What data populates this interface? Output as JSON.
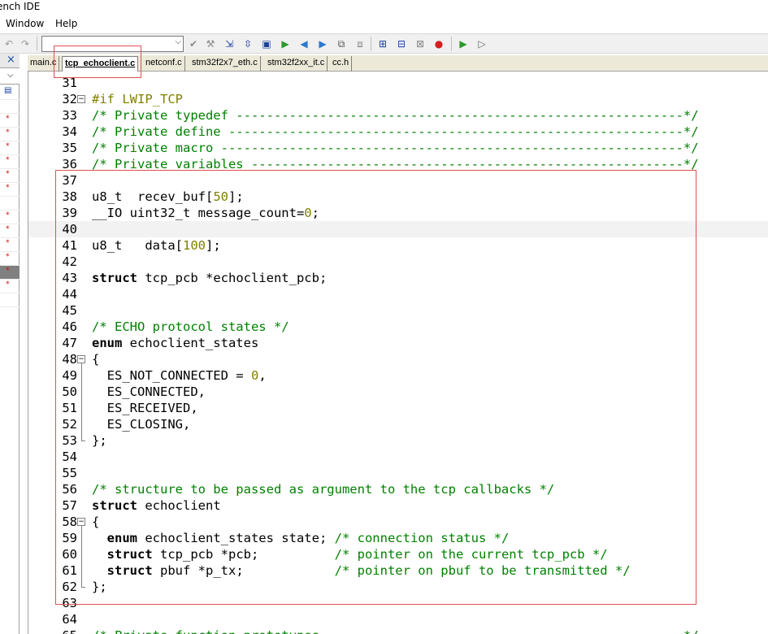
{
  "window": {
    "title": "ench IDE"
  },
  "menu": [
    {
      "label": "Window",
      "x": 7
    },
    {
      "label": "Help",
      "x": 68
    }
  ],
  "toolbar": {
    "combo_value": "",
    "combo_arrow": "⌵"
  },
  "left_pane": {
    "close_glyph": "×",
    "dropdown_glyph": "⌵"
  },
  "tabs": [
    {
      "label": "main.c",
      "active": false
    },
    {
      "label": "tcp_echoclient.c",
      "active": true
    },
    {
      "label": "netconf.c",
      "active": false
    },
    {
      "label": "stm32f2x7_eth.c",
      "active": false
    },
    {
      "label": "stm32f2xx_it.c",
      "active": false
    },
    {
      "label": "cc.h",
      "active": false
    }
  ],
  "code_lines": [
    {
      "n": "31",
      "tokens": []
    },
    {
      "n": "32",
      "fold": "open",
      "tokens": [
        {
          "t": "#if LWIP_TCP",
          "c": "pp"
        }
      ]
    },
    {
      "n": "33",
      "tokens": [
        {
          "t": "/* Private typedef -----------------------------------------------------------*/",
          "c": "cm"
        }
      ]
    },
    {
      "n": "34",
      "tokens": [
        {
          "t": "/* Private define ------------------------------------------------------------*/",
          "c": "cm"
        }
      ]
    },
    {
      "n": "35",
      "tokens": [
        {
          "t": "/* Private macro -------------------------------------------------------------*/",
          "c": "cm"
        }
      ]
    },
    {
      "n": "36",
      "tokens": [
        {
          "t": "/* Private variables ---------------------------------------------------------*/",
          "c": "cm"
        }
      ]
    },
    {
      "n": "37",
      "tokens": []
    },
    {
      "n": "38",
      "tokens": [
        {
          "t": "u8_t  recev_buf[",
          "c": "pl"
        },
        {
          "t": "50",
          "c": "num"
        },
        {
          "t": "];",
          "c": "pl"
        }
      ]
    },
    {
      "n": "39",
      "tokens": [
        {
          "t": "__IO uint32_t message_count=",
          "c": "pl"
        },
        {
          "t": "0",
          "c": "num"
        },
        {
          "t": ";",
          "c": "pl"
        }
      ]
    },
    {
      "n": "40",
      "hl": true,
      "tokens": []
    },
    {
      "n": "41",
      "tokens": [
        {
          "t": "u8_t   data[",
          "c": "pl"
        },
        {
          "t": "100",
          "c": "num"
        },
        {
          "t": "];",
          "c": "pl"
        }
      ]
    },
    {
      "n": "42",
      "tokens": []
    },
    {
      "n": "43",
      "tokens": [
        {
          "t": "struct",
          "c": "kw"
        },
        {
          "t": " tcp_pcb *echoclient_pcb;",
          "c": "pl"
        }
      ]
    },
    {
      "n": "44",
      "tokens": []
    },
    {
      "n": "45",
      "tokens": []
    },
    {
      "n": "46",
      "tokens": [
        {
          "t": "/* ECHO protocol states */",
          "c": "cm"
        }
      ]
    },
    {
      "n": "47",
      "tokens": [
        {
          "t": "enum",
          "c": "kw"
        },
        {
          "t": " echoclient_states",
          "c": "pl"
        }
      ]
    },
    {
      "n": "48",
      "fold": "open",
      "tokens": [
        {
          "t": "{",
          "c": "pl"
        }
      ]
    },
    {
      "n": "49",
      "tokens": [
        {
          "t": "  ES_NOT_CONNECTED = ",
          "c": "pl"
        },
        {
          "t": "0",
          "c": "num"
        },
        {
          "t": ",",
          "c": "pl"
        }
      ]
    },
    {
      "n": "50",
      "tokens": [
        {
          "t": "  ES_CONNECTED,",
          "c": "pl"
        }
      ]
    },
    {
      "n": "51",
      "tokens": [
        {
          "t": "  ES_RECEIVED,",
          "c": "pl"
        }
      ]
    },
    {
      "n": "52",
      "tokens": [
        {
          "t": "  ES_CLOSING,",
          "c": "pl"
        }
      ]
    },
    {
      "n": "53",
      "fold": "end",
      "tokens": [
        {
          "t": "};",
          "c": "pl"
        }
      ]
    },
    {
      "n": "54",
      "tokens": []
    },
    {
      "n": "55",
      "tokens": []
    },
    {
      "n": "56",
      "tokens": [
        {
          "t": "/* structure to be passed as argument to the tcp callbacks */",
          "c": "cm"
        }
      ]
    },
    {
      "n": "57",
      "tokens": [
        {
          "t": "struct",
          "c": "kw"
        },
        {
          "t": " echoclient",
          "c": "pl"
        }
      ]
    },
    {
      "n": "58",
      "fold": "open",
      "tokens": [
        {
          "t": "{",
          "c": "pl"
        }
      ]
    },
    {
      "n": "59",
      "tokens": [
        {
          "t": "  ",
          "c": "pl"
        },
        {
          "t": "enum",
          "c": "kw"
        },
        {
          "t": " echoclient_states state; ",
          "c": "pl"
        },
        {
          "t": "/* connection status */",
          "c": "cm"
        }
      ]
    },
    {
      "n": "60",
      "tokens": [
        {
          "t": "  ",
          "c": "pl"
        },
        {
          "t": "struct",
          "c": "kw"
        },
        {
          "t": " tcp_pcb *pcb;          ",
          "c": "pl"
        },
        {
          "t": "/* pointer on the current tcp_pcb */",
          "c": "cm"
        }
      ]
    },
    {
      "n": "61",
      "tokens": [
        {
          "t": "  ",
          "c": "pl"
        },
        {
          "t": "struct",
          "c": "kw"
        },
        {
          "t": " pbuf *p_tx;            ",
          "c": "pl"
        },
        {
          "t": "/* pointer on pbuf to be transmitted */",
          "c": "cm"
        }
      ]
    },
    {
      "n": "62",
      "fold": "end",
      "tokens": [
        {
          "t": "};",
          "c": "pl"
        }
      ]
    },
    {
      "n": "63",
      "tokens": []
    },
    {
      "n": "64",
      "tokens": []
    },
    {
      "n": "65",
      "tokens": [
        {
          "t": "/* Private function prototypes -----------------------------------------------*/",
          "c": "cm"
        }
      ]
    }
  ]
}
